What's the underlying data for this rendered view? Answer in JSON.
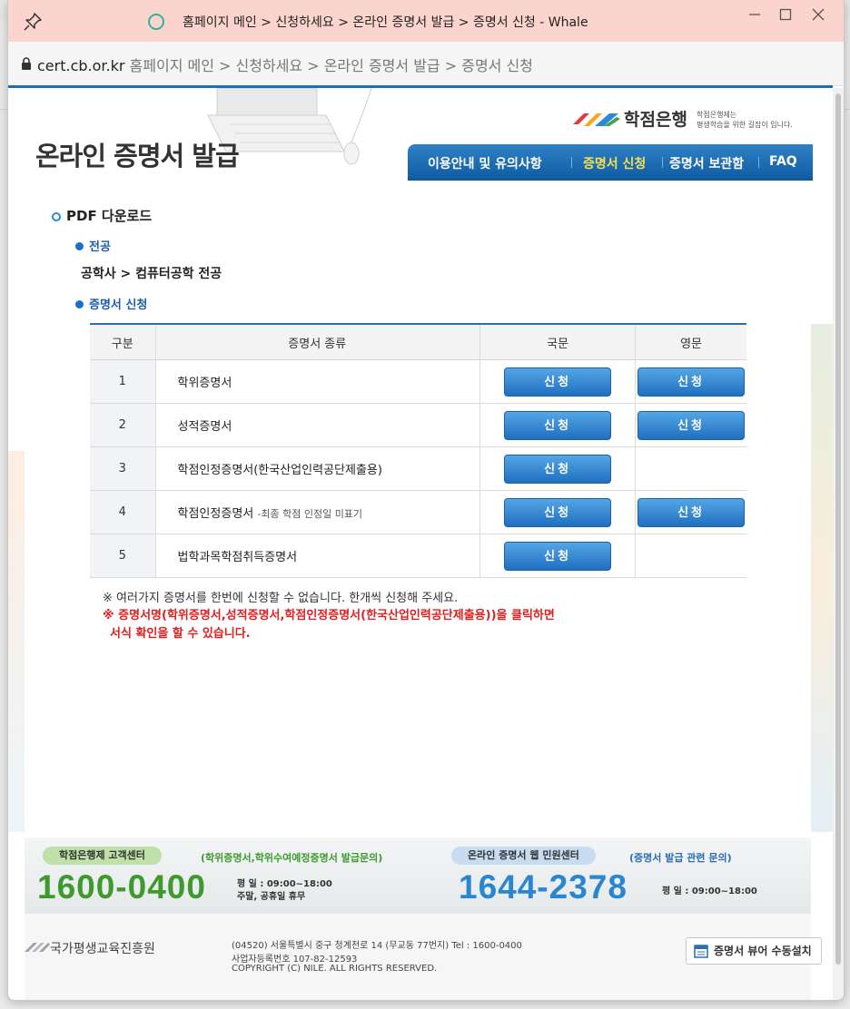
{
  "window": {
    "title": "홈페이지 메인 > 신청하세요 > 온라인 증명서 발급 > 증명서 신청 - Whale",
    "url_host": "cert.cb.or.kr",
    "url_path": "홈페이지 메인 > 신청하세요 > 온라인 증명서 발급 > 증명서 신청"
  },
  "header": {
    "site_title": "온라인 증명서 발급",
    "logo_name": "학점은행",
    "logo_tag_1": "학점은행제는",
    "logo_tag_2": "평생학습을 위한 길잡이 입니다.",
    "nav": [
      {
        "label": "이용안내 및 유의사항"
      },
      {
        "label": "증명서 신청"
      },
      {
        "label": "증명서 보관함"
      },
      {
        "label": "FAQ"
      }
    ]
  },
  "main": {
    "section_title": "PDF 다운로드",
    "major_head": "전공",
    "major_value": "공학사 > 컴퓨터공학 전공",
    "apply_head": "증명서 신청",
    "table": {
      "headers": [
        "구분",
        "증명서 종류",
        "국문",
        "영문"
      ],
      "rows": [
        {
          "num": "1",
          "name": "학위증명서",
          "note": "",
          "kr": "신청",
          "en": "신청"
        },
        {
          "num": "2",
          "name": "성적증명서",
          "note": "",
          "kr": "신청",
          "en": "신청"
        },
        {
          "num": "3",
          "name": "학점인정증명서(한국산업인력공단제출용)",
          "note": "",
          "kr": "신청",
          "en": ""
        },
        {
          "num": "4",
          "name": "학점인정증명서",
          "note": "-최종 학점 인정일 미표기",
          "kr": "신청",
          "en": "신청"
        },
        {
          "num": "5",
          "name": "법학과목학점취득증명서",
          "note": "",
          "kr": "신청",
          "en": ""
        }
      ]
    },
    "notice_1": "※ 여러가지 증명서를 한번에 신청할 수 없습니다. 한개씩 신청해 주세요.",
    "notice_2": "※ 증명서명(학위증명서,성적증명서,학점인정증명서(한국산업인력공단제출용))을 클릭하면",
    "notice_3": "서식 확인을 할 수 있습니다."
  },
  "footer": {
    "left_pill": "학점은행제 고객센터",
    "left_tag": "(학위증명서,학위수여예정증명서 발급문의)",
    "left_phone": "1600-0400",
    "left_hours_1": "평   일 : 09:00~18:00",
    "left_hours_2": "주말, 공휴일 휴무",
    "right_pill": "온라인 증명서 웹 민원센터",
    "right_tag": "(증명서 발급 관련 문의)",
    "right_phone": "1644-2378",
    "right_hours": "평   일 : 09:00~18:00",
    "org": "국가평생교육진흥원",
    "address": "(04520) 서울특별시 중구 청계천로 14 (무교동 77번지)   Tel : 1600-0400",
    "bizno": "사업자등록번호 107-82-12593",
    "copyright": "COPYRIGHT (C) NILE. ALL RIGHTS RESERVED.",
    "viewer_button": "증명서 뷰어 수동설치"
  },
  "colors": {
    "titlebar": "#fbd4cd",
    "nav_blue": "#1b6fb5",
    "active_nav": "#f3e150",
    "notice_red": "#e02020",
    "green_phone": "#3f9a2e",
    "blue_phone": "#2a86d0"
  },
  "icons": [
    "pin-icon",
    "loading-icon",
    "minimize-icon",
    "maximize-icon",
    "close-icon",
    "lock-icon",
    "viewer-icon"
  ]
}
